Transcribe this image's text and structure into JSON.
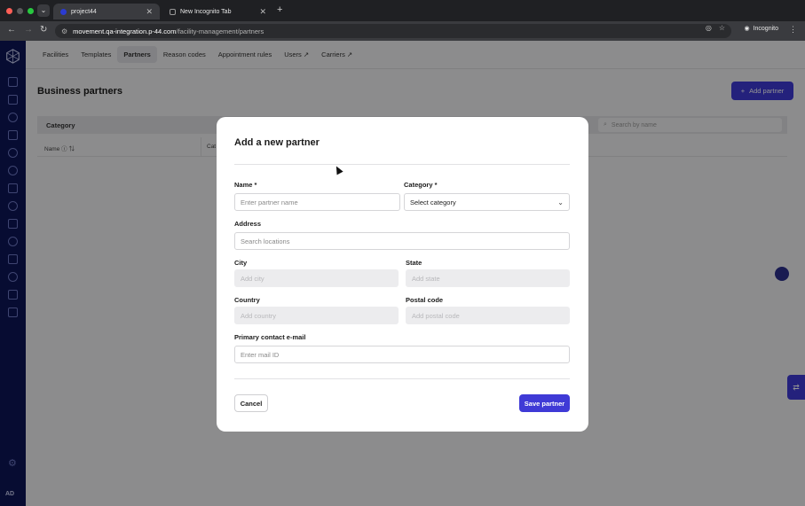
{
  "browser": {
    "tabs": [
      {
        "title": "project44",
        "active": true
      },
      {
        "title": "New Incognito Tab",
        "active": false
      }
    ],
    "url_host": "movement.qa-integration.p-44.com",
    "url_path": "/facility-management/partners",
    "incognito_label": "Incognito"
  },
  "sidebar": {
    "icons": [
      "dashboard-icon",
      "messages-icon",
      "users-icon",
      "routes-icon",
      "visibility-icon",
      "network-icon",
      "analytics-icon",
      "integrations-icon",
      "calendar-icon",
      "globe-icon",
      "chat-icon",
      "location-icon",
      "scan-icon",
      "schedule-icon"
    ],
    "avatar": "AD"
  },
  "subnav": {
    "items": [
      "Facilities",
      "Templates",
      "Partners",
      "Reason codes",
      "Appointment rules",
      "Users ↗",
      "Carriers ↗"
    ],
    "active": "Partners"
  },
  "page": {
    "title": "Business partners",
    "add_button": "Add partner",
    "filter_category": "Category",
    "search_placeholder": "Search by name",
    "col_name": "Name",
    "col_category": "Cat"
  },
  "modal": {
    "title": "Add a new partner",
    "name_label": "Name *",
    "name_placeholder": "Enter partner name",
    "category_label": "Category *",
    "category_value": "Select category",
    "address_label": "Address",
    "address_placeholder": "Search locations",
    "city_label": "City",
    "city_placeholder": "Add city",
    "state_label": "State",
    "state_placeholder": "Add state",
    "country_label": "Country",
    "country_placeholder": "Add country",
    "postal_label": "Postal code",
    "postal_placeholder": "Add postal code",
    "email_label": "Primary contact e-mail",
    "email_placeholder": "Enter mail ID",
    "cancel": "Cancel",
    "save": "Save partner"
  },
  "colors": {
    "accent": "#3f3ad6",
    "sidebar": "#0d1657"
  }
}
